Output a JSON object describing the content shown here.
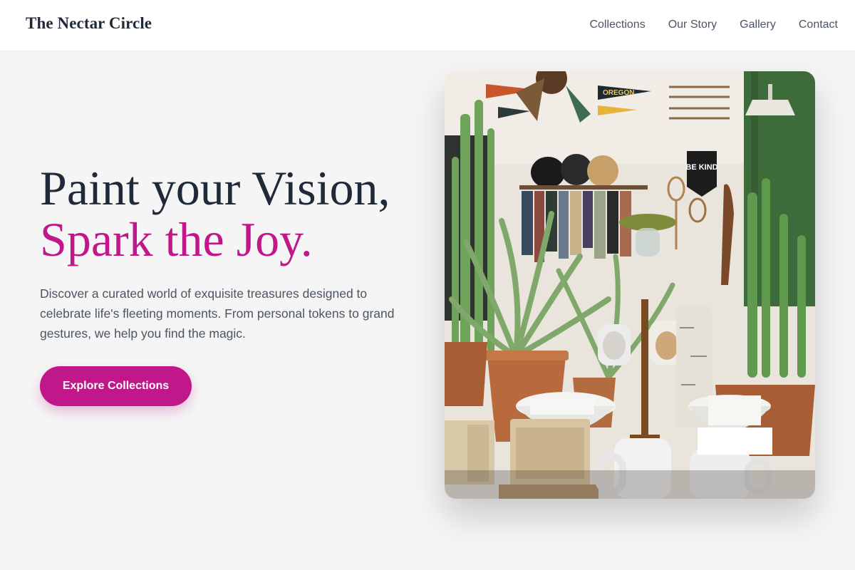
{
  "header": {
    "brand": "The Nectar Circle",
    "nav": [
      {
        "label": "Collections"
      },
      {
        "label": "Our Story"
      },
      {
        "label": "Gallery"
      },
      {
        "label": "Contact"
      }
    ]
  },
  "hero": {
    "headline_line1": "Paint your Vision,",
    "headline_line2": "Spark the Joy.",
    "description": "Discover a curated world of exquisite treasures designed to celebrate life's fleeting moments. From personal tokens to grand gestures, we help you find the magic.",
    "cta_label": "Explore Collections",
    "image": {
      "alt": "Boutique interior with cacti, mugs and pennants",
      "pennant_text": "OREGON",
      "banner_text": "BE KIND"
    }
  },
  "colors": {
    "accent": "#c0188a",
    "heading": "#1f2937",
    "body_text": "#4b5563",
    "background": "#f5f5f5"
  }
}
